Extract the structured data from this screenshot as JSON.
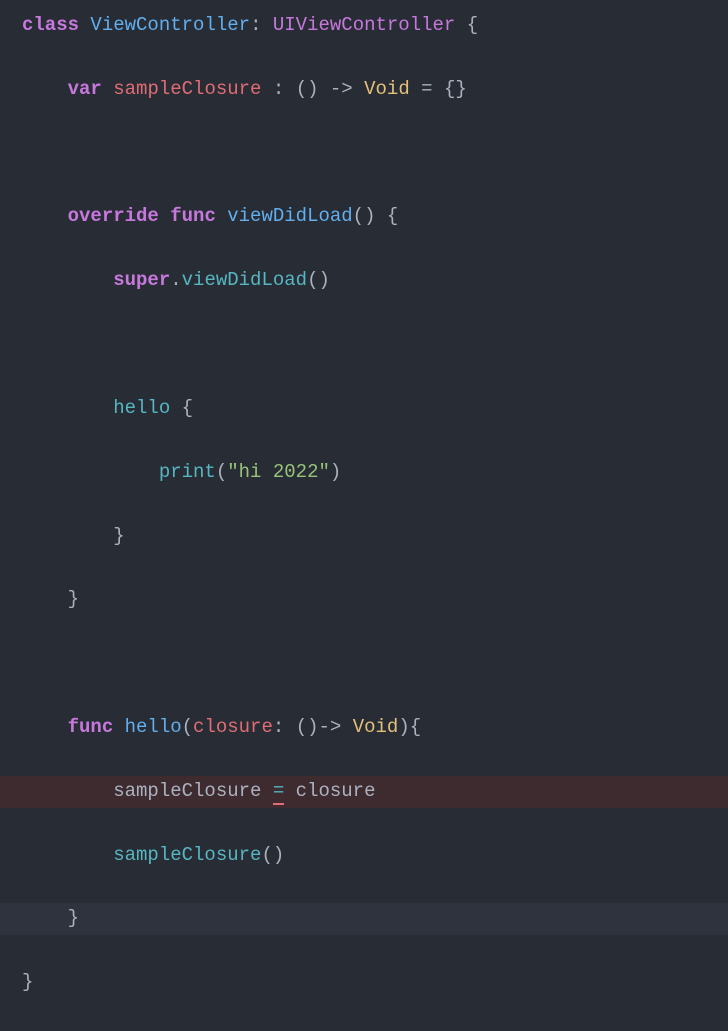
{
  "code": {
    "l1": {
      "kw_class": "class",
      "classname": "ViewController",
      "colon": ":",
      "supertype": "UIViewController",
      "brace": "{"
    },
    "l2": {
      "kw_var": "var",
      "name": "sampleClosure",
      "colon": " : ",
      "type_sig_open": "()",
      "arrow": " -> ",
      "void": "Void",
      "eq": " = ",
      "empty": "{}"
    },
    "l3": "",
    "l4": {
      "kw_override": "override",
      "kw_func": "func",
      "name": "viewDidLoad",
      "parens": "()",
      "brace": "{"
    },
    "l5": {
      "kw_super": "super",
      "dot": ".",
      "call": "viewDidLoad",
      "parens": "()"
    },
    "l6": "",
    "l7": {
      "hello": "hello",
      "brace": "{"
    },
    "l8": {
      "print": "print",
      "open": "(",
      "str": "\"hi 2022\"",
      "close": ")"
    },
    "l9": {
      "brace": "}"
    },
    "l10": {
      "brace": "}"
    },
    "l11": "",
    "l12": {
      "kw_func": "func",
      "name": "hello",
      "open": "(",
      "param": "closure",
      "colon": ": ",
      "sig_open": "()",
      "arrow": "-> ",
      "void": "Void",
      "close": ")",
      "brace": "{"
    },
    "l13": {
      "lhs": "sampleClosure",
      "eq": "=",
      "rhs": "closure"
    },
    "l14": {
      "call": "sampleClosure",
      "parens": "()"
    },
    "l15": {
      "brace": "}"
    },
    "l16": {
      "brace": "}"
    }
  }
}
